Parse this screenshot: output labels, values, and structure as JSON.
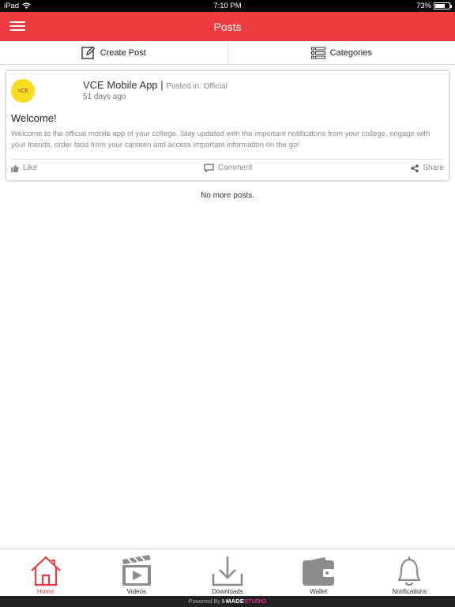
{
  "status_bar": {
    "device": "iPad",
    "time": "7:10 PM",
    "battery": "73%",
    "battery_level": 0.73
  },
  "header": {
    "title": "Posts"
  },
  "actions": {
    "create_post": "Create Post",
    "categories": "Categories"
  },
  "post": {
    "avatar_text": "VCE",
    "author": "VCE Mobile App",
    "separator": "|",
    "posted_in": "Posted in: Official",
    "time": "51 days ago",
    "title": "Welcome!",
    "body": "Welcome to the official mobile app of your college. Stay updated with the important notificatons from your college, engage with your friends, order food from your canteen and access important information on the go!",
    "like": "Like",
    "comment": "Comment",
    "share": "Share"
  },
  "feed": {
    "no_more": "No more posts."
  },
  "tabs": [
    {
      "label": "Home",
      "icon": "home-icon",
      "active": true
    },
    {
      "label": "Videos",
      "icon": "clapperboard-icon",
      "active": false
    },
    {
      "label": "Downloads",
      "icon": "download-icon",
      "active": false
    },
    {
      "label": "Wallet",
      "icon": "wallet-icon",
      "active": false
    },
    {
      "label": "Notifications",
      "icon": "bell-icon",
      "active": false
    }
  ],
  "footer": {
    "powered_by": "Powered By",
    "brand": "I-MADE",
    "brand_suffix": "STUDIO"
  },
  "colors": {
    "accent": "#ef3a40",
    "icon_gray": "#8c8c8c",
    "avatar_bg": "#f7dd1f"
  }
}
